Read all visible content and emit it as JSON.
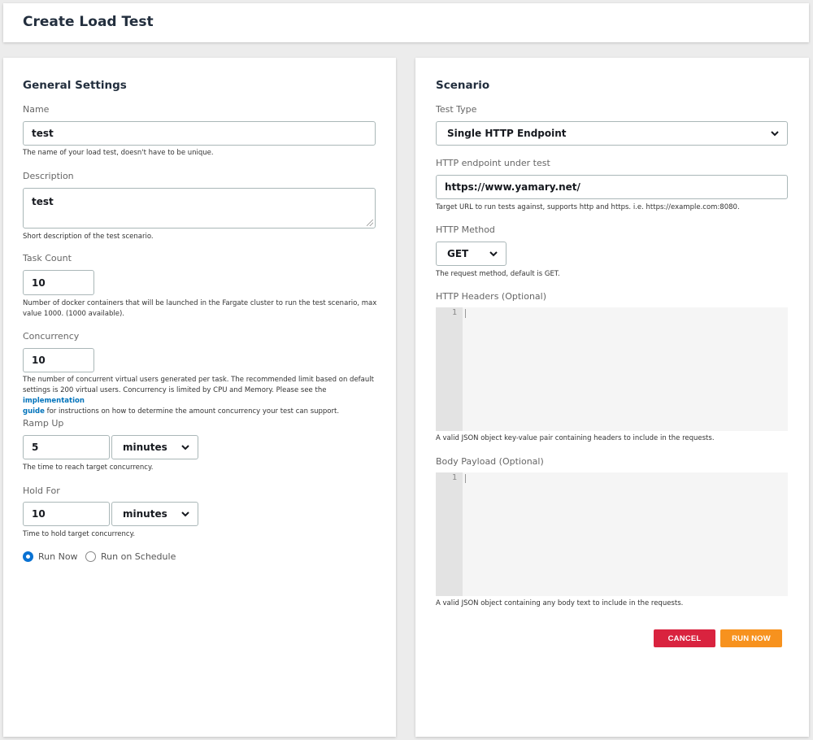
{
  "page": {
    "title": "Create Load Test"
  },
  "general": {
    "title": "General Settings",
    "name": {
      "label": "Name",
      "value": "test",
      "help": "The name of your load test, doesn't have to be unique."
    },
    "description": {
      "label": "Description",
      "value": "test",
      "help": "Short description of the test scenario."
    },
    "task_count": {
      "label": "Task Count",
      "value": "10",
      "help_line1": "Number of docker containers that will be launched in the Fargate cluster to run the test scenario, max",
      "help_line2": "value 1000. (1000 available)."
    },
    "concurrency": {
      "label": "Concurrency",
      "value": "10",
      "help_line1": "The number of concurrent virtual users generated per task. The recommended limit based on default",
      "help_line2_pre": "settings is 200 virtual users. Concurrency is limited by CPU and Memory. Please see the ",
      "help_link_part1": "implementation",
      "help_link_part2": "guide",
      "help_line3_post": " for instructions on how to determine the amount concurrency your test can support."
    },
    "ramp_up": {
      "label": "Ramp Up",
      "value": "5",
      "unit": "minutes",
      "help": "The time to reach target concurrency."
    },
    "hold_for": {
      "label": "Hold For",
      "value": "10",
      "unit": "minutes",
      "help": "Time to hold target concurrency."
    },
    "schedule": {
      "run_now": "Run Now",
      "run_on_schedule": "Run on Schedule",
      "selected": "run_now"
    }
  },
  "scenario": {
    "title": "Scenario",
    "test_type": {
      "label": "Test Type",
      "value": "Single HTTP Endpoint"
    },
    "endpoint": {
      "label": "HTTP endpoint under test",
      "value": "https://www.yamary.net/",
      "help": "Target URL to run tests against, supports http and https. i.e. https://example.com:8080."
    },
    "method": {
      "label": "HTTP Method",
      "value": "GET",
      "help": "The request method, default is GET."
    },
    "headers": {
      "label": "HTTP Headers (Optional)",
      "line_number": "1",
      "help": "A valid JSON object key-value pair containing headers to include in the requests."
    },
    "body": {
      "label": "Body Payload (Optional)",
      "line_number": "1",
      "help": "A valid JSON object containing any body text to include in the requests."
    }
  },
  "actions": {
    "cancel": "CANCEL",
    "run_now": "RUN NOW"
  },
  "colors": {
    "link": "#0073bb",
    "cancel": "#d9233f",
    "run": "#f7921e",
    "radio": "#0972d3"
  },
  "icons": {
    "select_arrow": "chevron-down-icon"
  }
}
